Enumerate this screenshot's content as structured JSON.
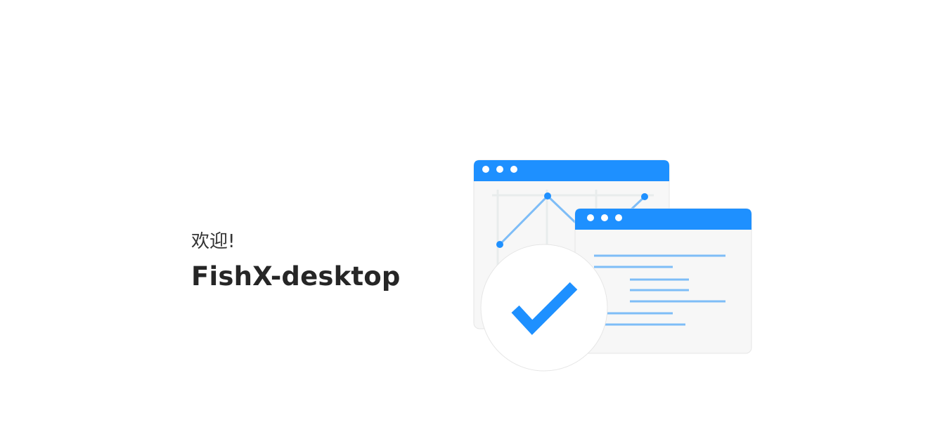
{
  "welcome": {
    "greeting": "欢迎!",
    "app_name": "FishX-desktop"
  },
  "illustration": {
    "accent_color": "#1e90ff",
    "line_color": "#7ebdf7",
    "panel_bg": "#f7f7f7",
    "icon": "checkmark-icon"
  }
}
